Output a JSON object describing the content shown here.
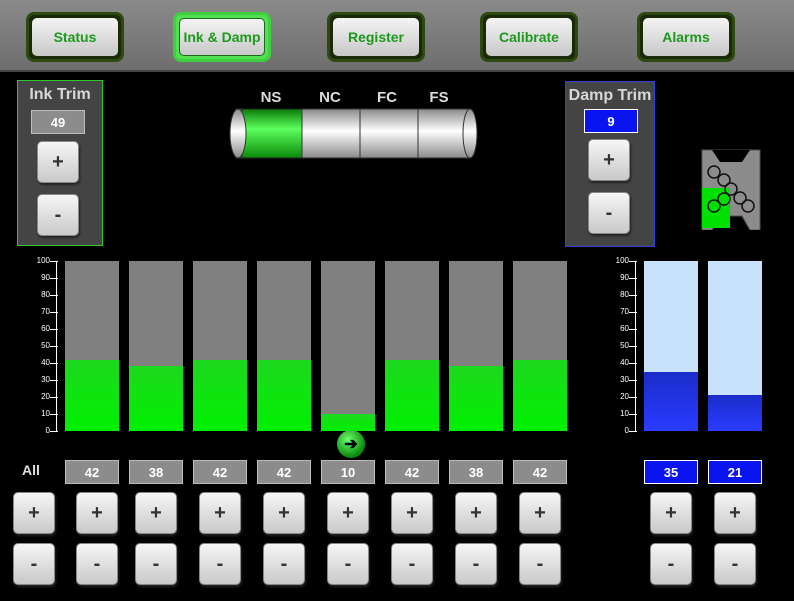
{
  "nav": [
    {
      "label": "Status",
      "active": false
    },
    {
      "label": "Ink & Damp",
      "active": true
    },
    {
      "label": "Register",
      "active": false
    },
    {
      "label": "Calibrate",
      "active": false
    },
    {
      "label": "Alarms",
      "active": false
    }
  ],
  "ink_trim": {
    "title": "Ink Trim",
    "value": "49",
    "plus": "+",
    "minus": "-"
  },
  "damp_trim": {
    "title": "Damp Trim",
    "value": "9",
    "plus": "+",
    "minus": "-"
  },
  "cylinder": {
    "labels": [
      "NS",
      "NC",
      "FC",
      "FS"
    ],
    "selected": "NS"
  },
  "axis_ticks": [
    "100",
    "90",
    "80",
    "70",
    "60",
    "50",
    "40",
    "30",
    "20",
    "10",
    "0"
  ],
  "ink_keys": {
    "all_label": "All",
    "values": [
      "42",
      "38",
      "42",
      "42",
      "10",
      "42",
      "38",
      "42"
    ],
    "levels": [
      42,
      38,
      42,
      42,
      10,
      42,
      38,
      42
    ],
    "plus": "+",
    "minus": "-"
  },
  "damp_keys": {
    "values": [
      "35",
      "21"
    ],
    "levels": [
      35,
      21
    ],
    "plus": "+",
    "minus": "-"
  },
  "colors": {
    "ink_fill": "#00f000",
    "damp_fill": "#2a3cff",
    "active_nav": "#52e052"
  },
  "arrow_icon": "arrow-right-icon"
}
